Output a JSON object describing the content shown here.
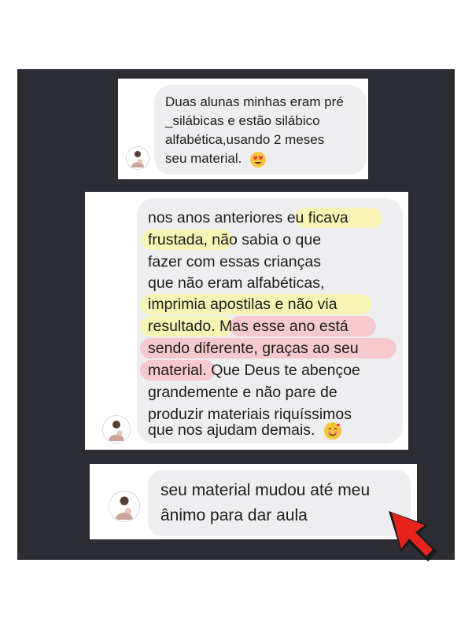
{
  "messages": [
    {
      "lines": [
        "Duas alunas minhas eram pré",
        "_silábicas e estão silábico",
        "alfabética,usando  2 meses",
        "seu material."
      ],
      "emoji": "heart-eyes-emoji"
    },
    {
      "lines": [
        "nos anos anteriores eu ficava",
        "frustada, não sabia o que",
        "fazer com essas crianças",
        "que não eram alfabéticas,",
        "imprimia apostilas e não via",
        "resultado. Mas esse ano está",
        "sendo diferente, graças ao seu",
        "material. Que Deus te abençoe",
        "grandemente e não pare de",
        "produzir materiais riquíssimos",
        "que nos ajudam demais."
      ],
      "emoji": "smiling-face-with-hearts-emoji"
    },
    {
      "lines": [
        "seu material mudou até meu",
        "ânimo para dar aula"
      ]
    }
  ],
  "colors": {
    "background_panel": "#2b2d33",
    "bubble": "#eeeef0",
    "highlight_yellow": "#f6f3b4",
    "highlight_pink": "#f5c9cd",
    "arrow": "#e8231e"
  }
}
